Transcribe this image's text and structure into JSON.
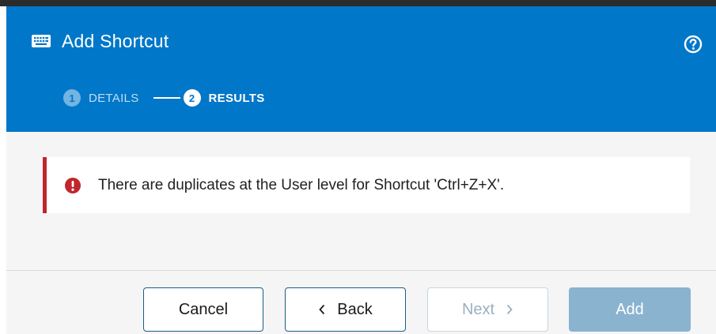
{
  "theme": {
    "accent": "#0177c9",
    "danger": "#c0262d"
  },
  "dialog": {
    "title": "Add Shortcut",
    "title_icon": "keyboard-icon",
    "help_icon": "help-circle-icon"
  },
  "steps": [
    {
      "number": "1",
      "label": "DETAILS",
      "active": false
    },
    {
      "number": "2",
      "label": "RESULTS",
      "active": true
    }
  ],
  "alert": {
    "icon": "error-circle-icon",
    "message": "There are duplicates at the User level for Shortcut 'Ctrl+Z+X'."
  },
  "footer": {
    "cancel_label": "Cancel",
    "back_label": "Back",
    "next_label": "Next",
    "add_label": "Add"
  }
}
